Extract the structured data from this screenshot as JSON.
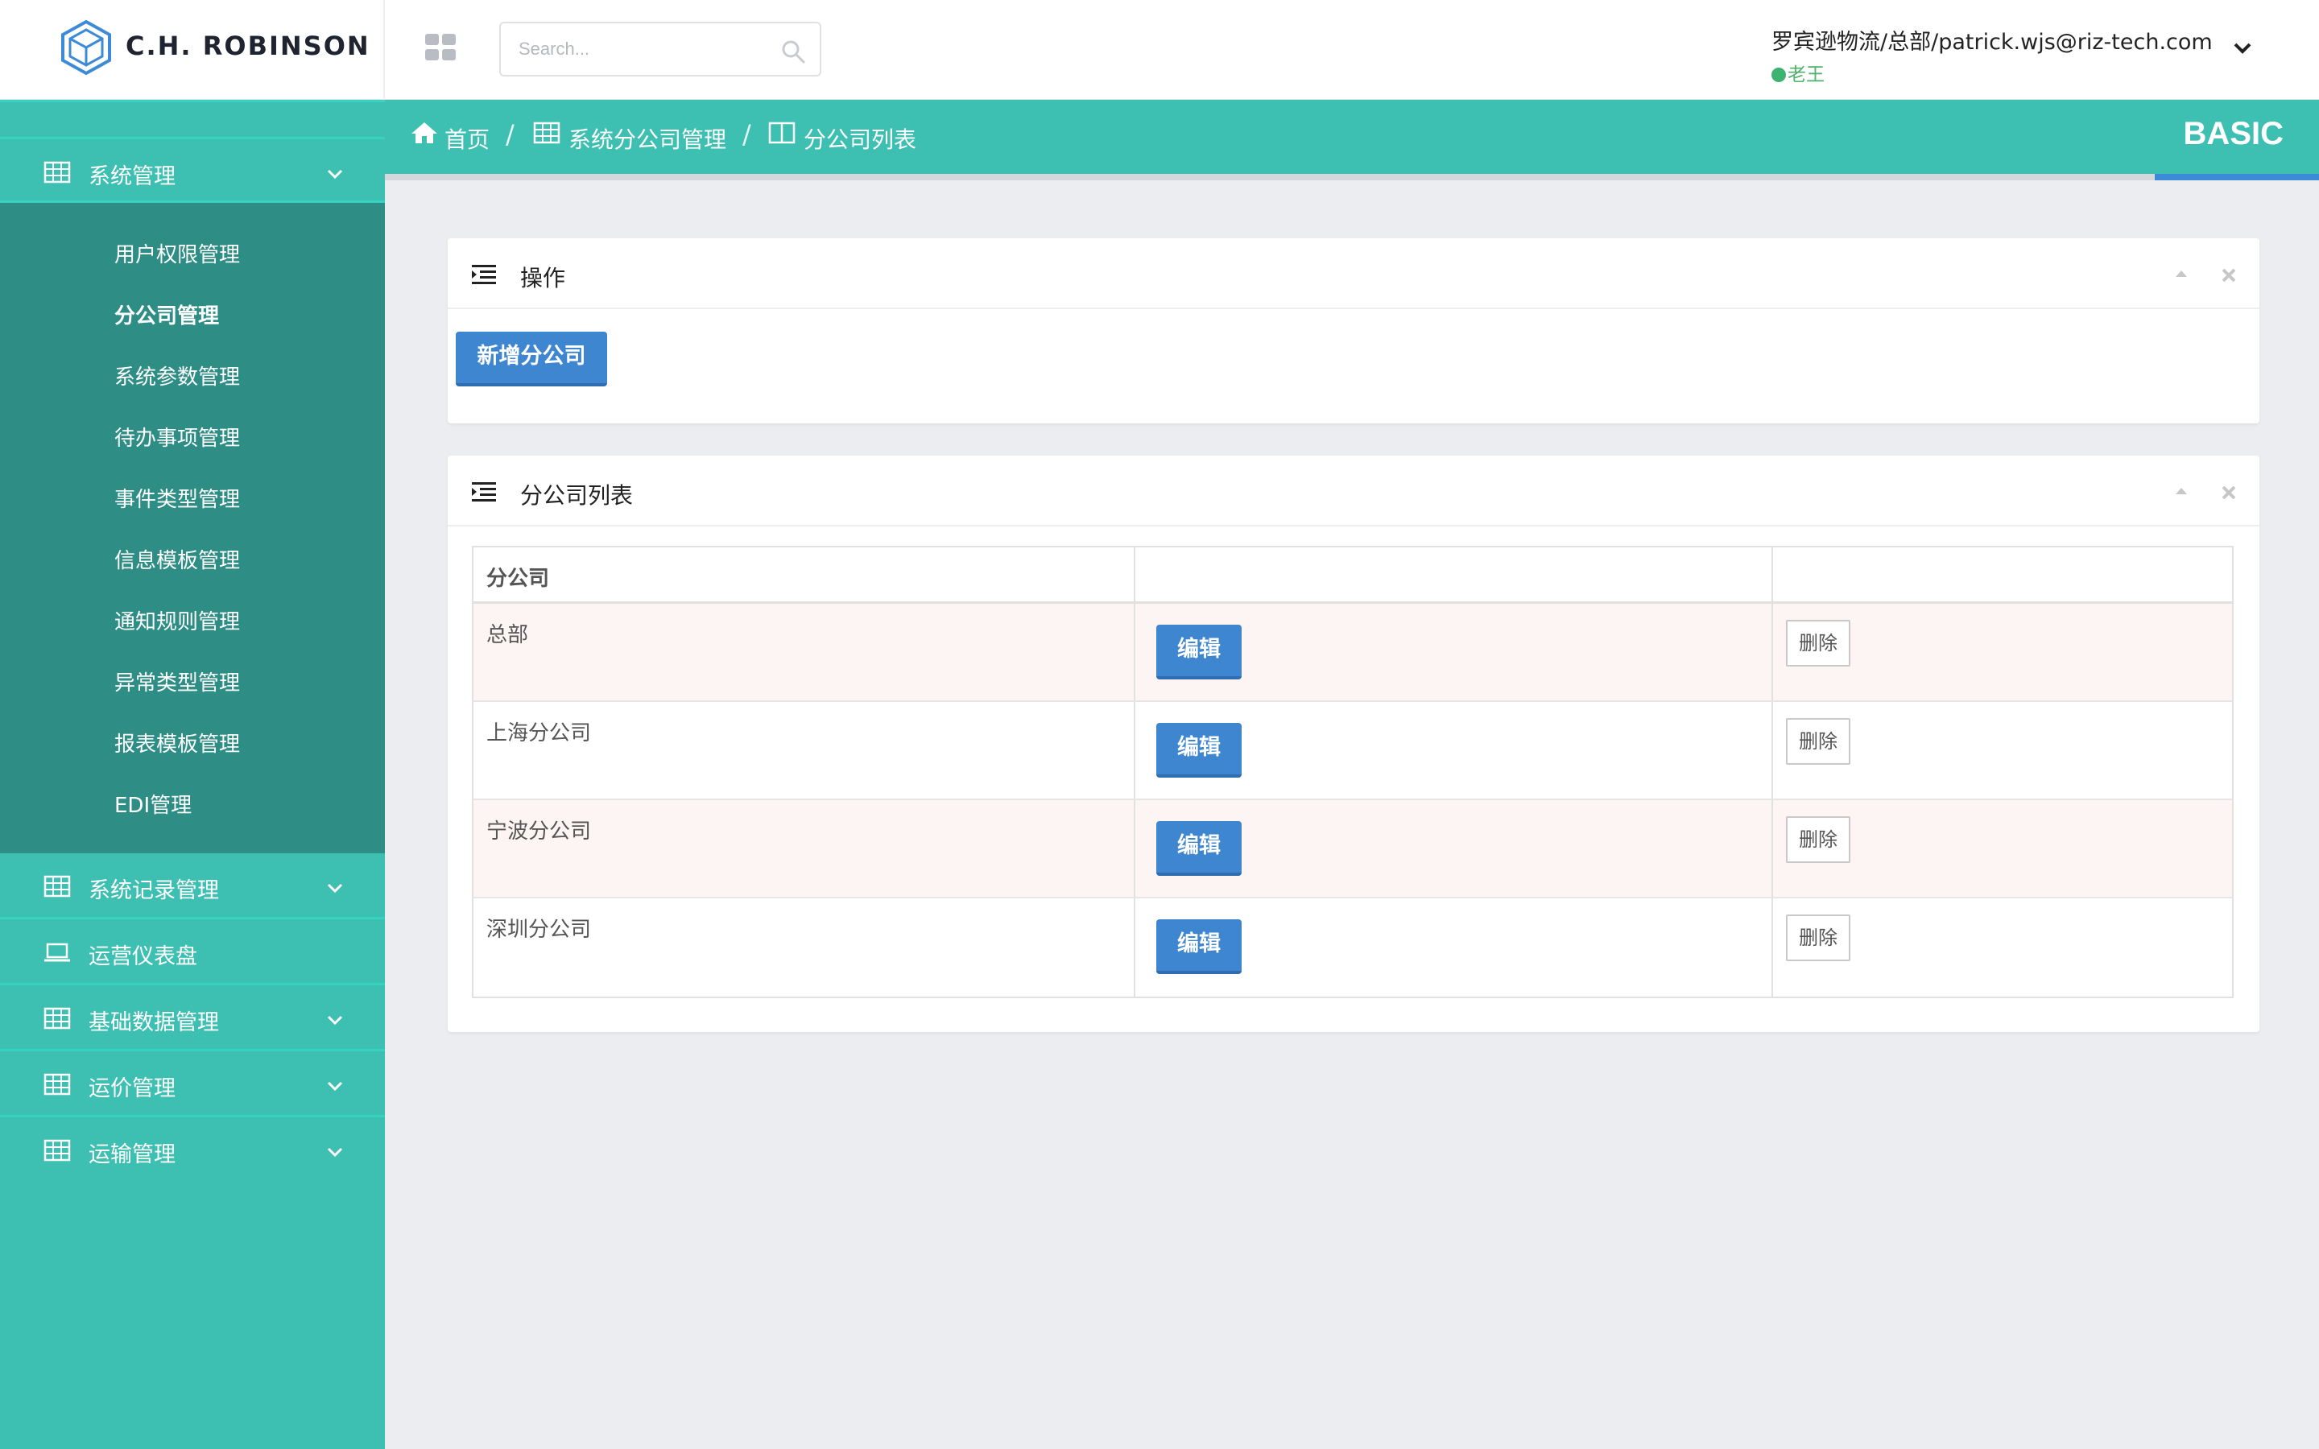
{
  "brand": {
    "name": "C.H. ROBINSON",
    "logo_icon": "cube-hexagon-icon",
    "color": "#3d8bd6"
  },
  "header": {
    "apps_icon": "apps-grid-icon",
    "search": {
      "placeholder": "Search...",
      "icon": "search-icon"
    },
    "user": {
      "name": "罗宾逊物流/总部/patrick.wjs@riz-tech.com",
      "status": "老王",
      "menu_icon": "chevron-down-icon"
    }
  },
  "sidebar": {
    "accent_color": "#3dbfb2",
    "groups": [
      {
        "label": "系统管理",
        "icon": "table-icon",
        "expanded": true,
        "items": [
          {
            "label": "用户权限管理"
          },
          {
            "label": "分公司管理",
            "active": true
          },
          {
            "label": "系统参数管理"
          },
          {
            "label": "待办事项管理"
          },
          {
            "label": "事件类型管理"
          },
          {
            "label": "信息模板管理"
          },
          {
            "label": "通知规则管理"
          },
          {
            "label": "异常类型管理"
          },
          {
            "label": "报表模板管理"
          },
          {
            "label": "EDI管理"
          }
        ]
      },
      {
        "label": "系统记录管理",
        "icon": "table-icon"
      },
      {
        "label": "运营仪表盘",
        "icon": "laptop-icon"
      },
      {
        "label": "基础数据管理",
        "icon": "table-icon"
      },
      {
        "label": "运价管理",
        "icon": "table-icon"
      },
      {
        "label": "运输管理",
        "icon": "table-icon"
      }
    ]
  },
  "breadcrumb": {
    "items": [
      {
        "label": "首页",
        "icon": "home-icon"
      },
      {
        "label": "系统分公司管理",
        "icon": "table-icon"
      },
      {
        "label": "分公司列表",
        "icon": "columns-icon"
      }
    ],
    "separator": "/",
    "edition": "BASIC"
  },
  "actions_panel": {
    "title": "操作",
    "add_button": "新增分公司"
  },
  "list_panel": {
    "title": "分公司列表",
    "columns": [
      "分公司",
      "",
      ""
    ],
    "rows": [
      {
        "name": "总部",
        "edit": "编辑",
        "delete": "删除"
      },
      {
        "name": "上海分公司",
        "edit": "编辑",
        "delete": "删除"
      },
      {
        "name": "宁波分公司",
        "edit": "编辑",
        "delete": "删除"
      },
      {
        "name": "深圳分公司",
        "edit": "编辑",
        "delete": "删除"
      }
    ]
  }
}
